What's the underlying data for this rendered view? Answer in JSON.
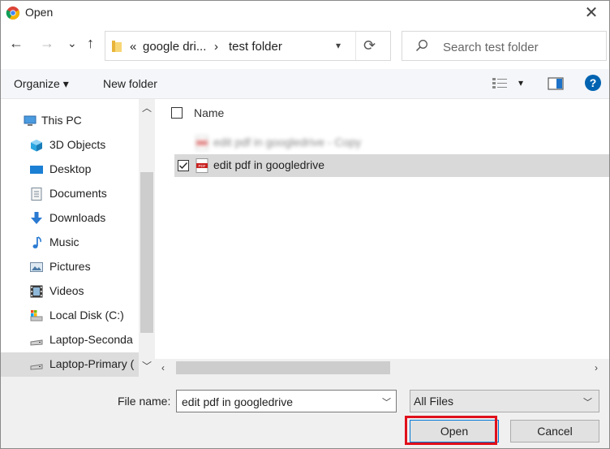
{
  "window": {
    "title": "Open",
    "app_icon": "chrome-icon",
    "close_label": "✕"
  },
  "nav": {
    "back": "←",
    "forward": "→",
    "recent": "⌄",
    "up": "↑"
  },
  "address": {
    "overflow": "«",
    "crumbs": [
      "google dri...",
      "test folder"
    ],
    "separator": "›",
    "refresh": "⟳"
  },
  "search": {
    "placeholder": "Search test folder"
  },
  "toolbar": {
    "organize": "Organize ▾",
    "new_folder": "New folder",
    "view_dd": "▾",
    "help": "?"
  },
  "sidebar": {
    "items": [
      {
        "label": "This PC",
        "icon": "this-pc-icon"
      },
      {
        "label": "3D Objects",
        "icon": "3d-objects-icon"
      },
      {
        "label": "Desktop",
        "icon": "desktop-icon"
      },
      {
        "label": "Documents",
        "icon": "documents-icon"
      },
      {
        "label": "Downloads",
        "icon": "downloads-icon"
      },
      {
        "label": "Music",
        "icon": "music-icon"
      },
      {
        "label": "Pictures",
        "icon": "pictures-icon"
      },
      {
        "label": "Videos",
        "icon": "videos-icon"
      },
      {
        "label": "Local Disk (C:)",
        "icon": "local-disk-icon"
      },
      {
        "label": "Laptop-Seconda",
        "icon": "drive-icon"
      },
      {
        "label": "Laptop-Primary (",
        "icon": "drive-icon"
      }
    ],
    "selected_index": 10
  },
  "files": {
    "column_name": "Name",
    "rows": [
      {
        "name": "edit pdf in googledrive - Copy",
        "icon": "pdf-icon",
        "checked": false,
        "blurred": true
      },
      {
        "name": "edit pdf in googledrive",
        "icon": "pdf-icon",
        "checked": true,
        "blurred": false
      }
    ]
  },
  "bottom": {
    "file_name_label": "File name:",
    "file_name_value": "edit pdf in googledrive",
    "file_type_value": "All Files",
    "open_label": "Open",
    "cancel_label": "Cancel"
  },
  "colors": {
    "highlight": "#e0101b",
    "help_blue": "#0063b1",
    "pdf_red": "#c8201e"
  }
}
